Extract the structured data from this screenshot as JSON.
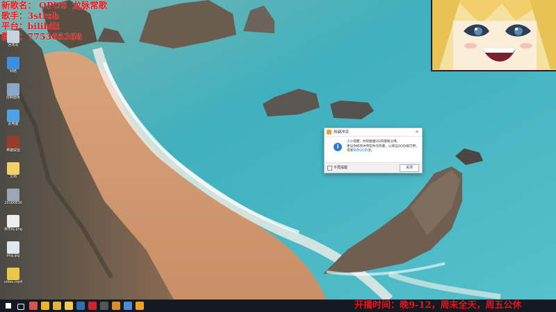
{
  "overlay": {
    "line1_a": "新歌名：",
    "line1_b": "OPUS",
    "line1_c": "龙脉常歌",
    "line2": "歌手：3stroh",
    "line3": "平台：bilibili",
    "line4": "群号：775365368"
  },
  "desktop_icons": [
    {
      "label": "回收站",
      "color": "#c9d3dd"
    },
    {
      "label": "网络",
      "color": "#3b8fe0"
    },
    {
      "label": "控制面板",
      "color": "#8aa6c8"
    },
    {
      "label": "此电脑",
      "color": "#4ea3e8"
    },
    {
      "label": "英雄联盟",
      "color": "#9b3b2b"
    },
    {
      "label": "文档",
      "color": "#f3d06a"
    },
    {
      "label": "20180830",
      "color": "#9aa8b6"
    },
    {
      "label": "条形码.png",
      "color": "#eeeeee"
    },
    {
      "label": "img.jpg",
      "color": "#dfe7ef"
    },
    {
      "label": "video.mp4",
      "color": "#e8c74a"
    }
  ],
  "dialog": {
    "title": "热键冲突",
    "close": "×",
    "message_a": "小小提醒：你的截图QQ热键被占用。",
    "message_b": "建议你修改冲突软件的热键，以保证QQ功能可用，或者",
    "message_link": "修改QQ热键",
    "message_end": "。",
    "checkbox_label": "不再提醒",
    "button_label": "关闭",
    "info_glyph": "i"
  },
  "taskbar": {
    "ticker": "开播时间：晚9-12，周末全天，周五公休",
    "items": [
      {
        "name": "start-icon",
        "color": "#ffffff"
      },
      {
        "name": "task-view-icon",
        "color": "#ffffff"
      },
      {
        "name": "app1-icon",
        "color": "#d9534f"
      },
      {
        "name": "app2-icon",
        "color": "#f0b429"
      },
      {
        "name": "chrome-icon",
        "color": "#e3b341"
      },
      {
        "name": "explorer-icon",
        "color": "#f2c94c"
      },
      {
        "name": "steam-icon",
        "color": "#2f6fab"
      },
      {
        "name": "netease-icon",
        "color": "#d3222a"
      },
      {
        "name": "obs-icon",
        "color": "#555555"
      },
      {
        "name": "app3-icon",
        "color": "#e08a2b"
      },
      {
        "name": "app4-icon",
        "color": "#4b8ad6"
      },
      {
        "name": "qq-icon",
        "color": "#f4a21c"
      }
    ]
  }
}
